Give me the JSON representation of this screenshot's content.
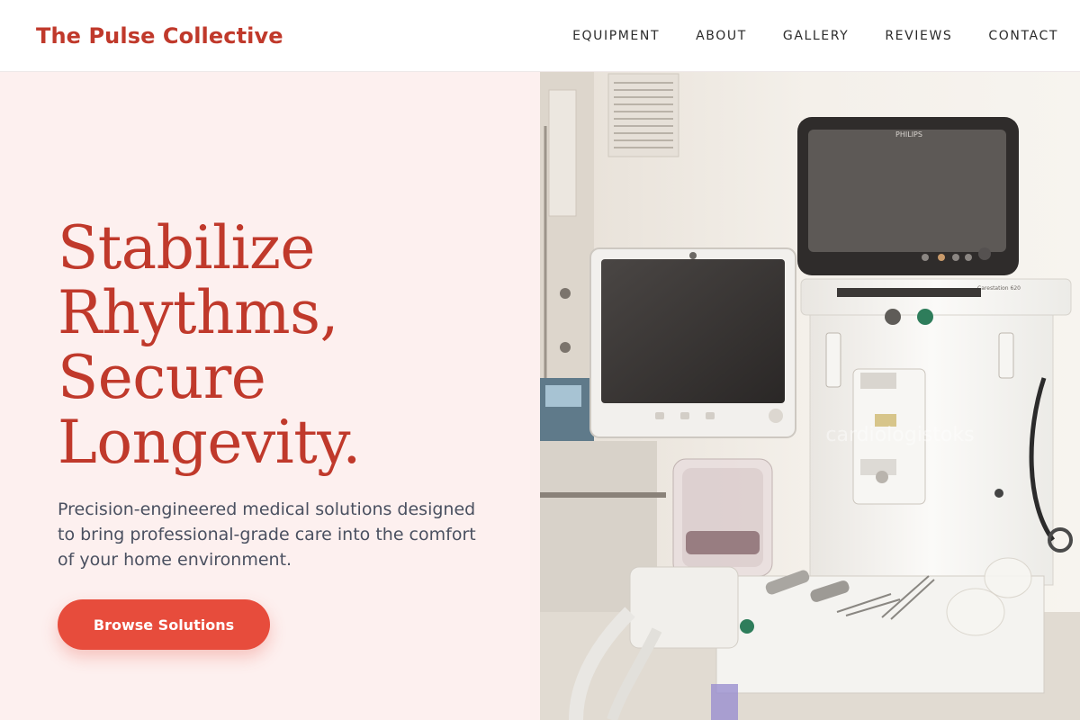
{
  "header": {
    "brand": "The Pulse Collective",
    "nav": [
      {
        "label": "EQUIPMENT"
      },
      {
        "label": "ABOUT"
      },
      {
        "label": "GALLERY"
      },
      {
        "label": "REVIEWS"
      },
      {
        "label": "CONTACT"
      }
    ]
  },
  "hero": {
    "headline_lines": [
      "Stabilize",
      "Rhythms,",
      "Secure",
      "Longevity."
    ],
    "subtext": "Precision-engineered medical solutions designed to bring professional-grade care into the comfort of your home environment.",
    "cta_label": "Browse Solutions",
    "image": {
      "subject": "anesthesia-machine-photo",
      "monitor_brand": "PHILIPS",
      "machine_model": "Carestation 620",
      "watermark": "cardiologistoks"
    }
  },
  "colors": {
    "brand": "#c0392b",
    "accent": "#e74c3c",
    "hero_bg": "#fdf0ef",
    "body_text": "#4a5060"
  }
}
